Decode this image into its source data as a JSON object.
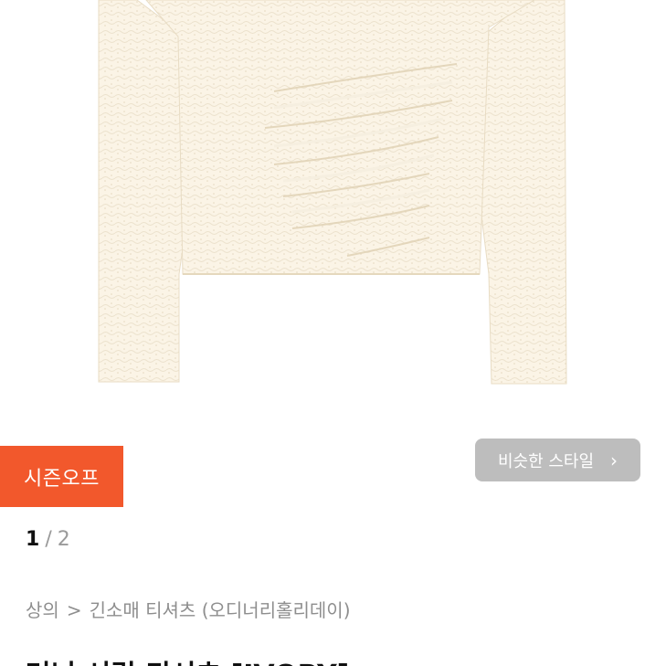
{
  "badge": {
    "label": "시즌오프",
    "color": "#f2582c"
  },
  "similar_style": {
    "label": "비슷한 스타일",
    "icon": "chevron-right-icon"
  },
  "pagination": {
    "current": "1",
    "separator": "/",
    "total": "2"
  },
  "breadcrumb": {
    "items": [
      "상의",
      "긴소매 티셔츠 (오디너리홀리데이)"
    ],
    "separator": ">"
  },
  "product": {
    "title": "러닝 셔링 티셔츠 [IVORY]",
    "image_subject": "ivory shirred long-sleeve t-shirt"
  }
}
